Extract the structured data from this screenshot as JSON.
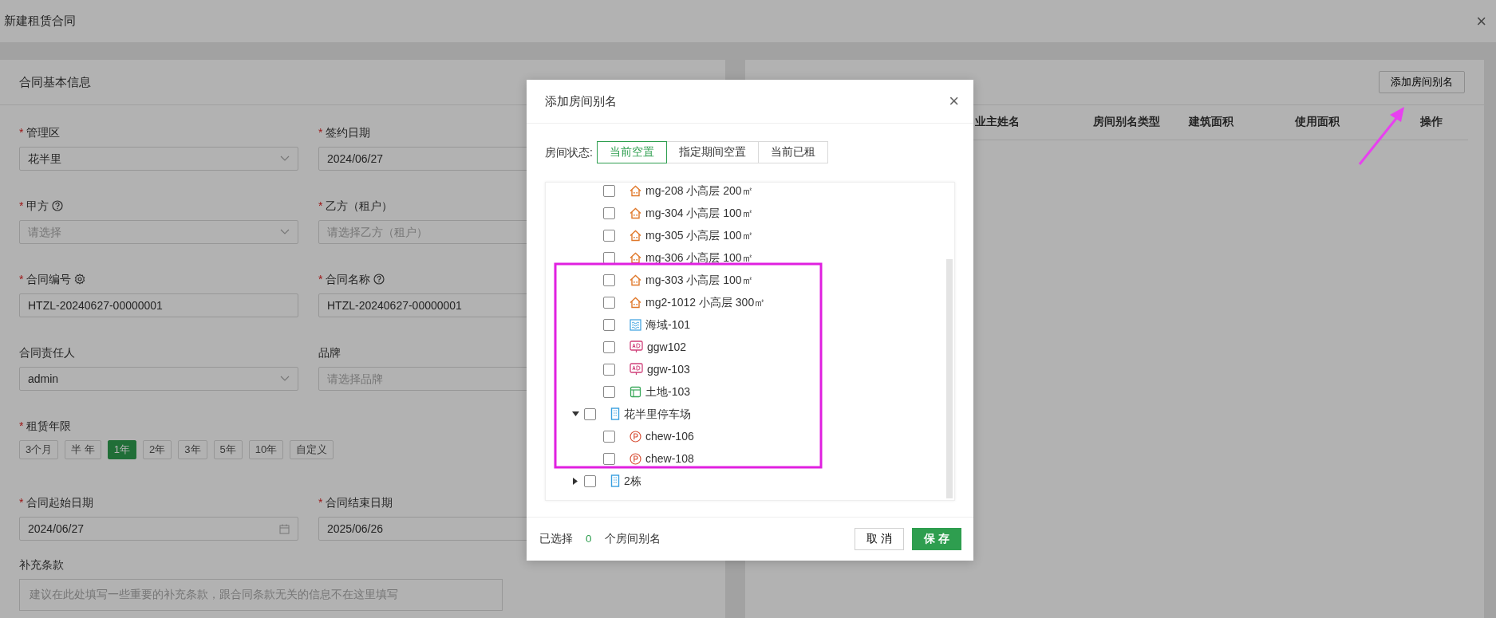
{
  "window": {
    "title": "新建租赁合同",
    "close": "×"
  },
  "form": {
    "title": "合同基本信息",
    "required_mark": "*",
    "fields": [
      {
        "label": "管理区",
        "required": true,
        "kind": "select",
        "value": "花半里"
      },
      {
        "label": "签约日期",
        "required": true,
        "kind": "input",
        "value": "2024/06/27"
      },
      {
        "label": "甲方",
        "required": true,
        "help_icon": true,
        "kind": "select",
        "placeholder": "请选择"
      },
      {
        "label": "乙方（租户）",
        "required": true,
        "kind": "input",
        "placeholder": "请选择乙方（租户）"
      },
      {
        "label": "合同编号",
        "required": true,
        "settings_icon": true,
        "kind": "input",
        "value": "HTZL-20240627-00000001"
      },
      {
        "label": "合同名称",
        "required": true,
        "help_icon": true,
        "kind": "input",
        "value": "HTZL-20240627-00000001"
      },
      {
        "label": "合同责任人",
        "required": false,
        "kind": "select",
        "value": "admin"
      },
      {
        "label": "品牌",
        "required": false,
        "kind": "input",
        "placeholder": "请选择品牌"
      }
    ],
    "term": {
      "label": "租赁年限",
      "required": true,
      "options": [
        {
          "label": "3个月",
          "selected": false
        },
        {
          "label": "半 年",
          "selected": false
        },
        {
          "label": "1年",
          "selected": true
        },
        {
          "label": "2年",
          "selected": false
        },
        {
          "label": "3年",
          "selected": false
        },
        {
          "label": "5年",
          "selected": false
        },
        {
          "label": "10年",
          "selected": false
        },
        {
          "label": "自定义",
          "selected": false
        }
      ]
    },
    "dates": [
      {
        "label": "合同起始日期",
        "required": true,
        "kind": "date",
        "value": "2024/06/27"
      },
      {
        "label": "合同结束日期",
        "required": true,
        "kind": "input",
        "value": "2025/06/26"
      }
    ],
    "notes": {
      "label": "补充条款",
      "required": false,
      "placeholder": "建议在此处填写一些重要的补充条款，跟合同条款无关的信息不在这里填写"
    }
  },
  "rooms": {
    "add_button": "添加房间别名",
    "columns": [
      "业主姓名",
      "房间别名类型",
      "建筑面积",
      "使用面积",
      "操作"
    ]
  },
  "modal": {
    "title": "添加房间别名",
    "close": "×",
    "status_label": "房间状态:",
    "status_tabs": [
      {
        "label": "当前空置",
        "selected": true
      },
      {
        "label": "指定期间空置",
        "selected": false
      },
      {
        "label": "当前已租",
        "selected": false
      }
    ],
    "tree": {
      "partial_branch": [
        {
          "label": "mg-208 小高层 200㎡",
          "kind": "house",
          "checked": false
        },
        {
          "label": "mg-304 小高层 100㎡",
          "kind": "house",
          "checked": false
        },
        {
          "label": "mg-305 小高层 100㎡",
          "kind": "house",
          "checked": false
        },
        {
          "label": "mg-306 小高层 100㎡",
          "kind": "house",
          "checked": false
        },
        {
          "label": "mg-303 小高层 100㎡",
          "kind": "house",
          "checked": false
        },
        {
          "label": "mg2-1012 小高层 300㎡",
          "kind": "house",
          "checked": false
        },
        {
          "label": "海域-101",
          "kind": "sea",
          "checked": false
        },
        {
          "label": "ggw102",
          "kind": "ad",
          "checked": false
        },
        {
          "label": "ggw-103",
          "kind": "ad",
          "checked": false
        },
        {
          "label": "土地-103",
          "kind": "land",
          "checked": false
        }
      ],
      "nodes": [
        {
          "label": "花半里停车场",
          "kind": "building",
          "checked": false,
          "expanded": true,
          "children": [
            {
              "label": "chew-106",
              "kind": "parking",
              "checked": false
            },
            {
              "label": "chew-108",
              "kind": "parking",
              "checked": false
            }
          ]
        },
        {
          "label": "2栋",
          "kind": "building",
          "checked": false,
          "expanded": false
        }
      ]
    },
    "selected_prefix": "已选择",
    "selected_count": "0",
    "selected_suffix": "个房间别名",
    "cancel": "取 消",
    "save": "保 存"
  }
}
